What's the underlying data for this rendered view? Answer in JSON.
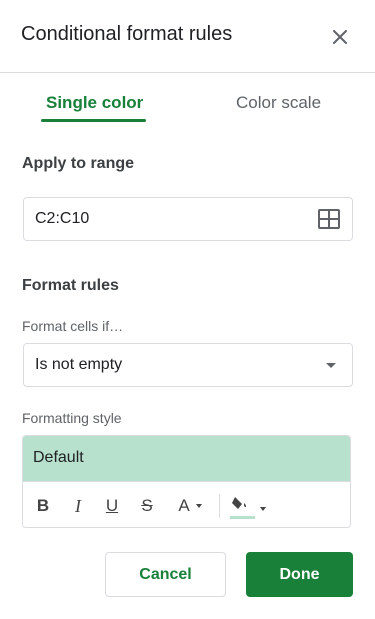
{
  "dialog": {
    "title": "Conditional format rules",
    "close_icon": "close-icon"
  },
  "tabs": [
    {
      "label": "Single color",
      "active": true
    },
    {
      "label": "Color scale",
      "active": false
    }
  ],
  "range": {
    "label": "Apply to range",
    "value": "C2:C10",
    "icon": "grid-select-icon"
  },
  "format_rules": {
    "label": "Format rules",
    "condition_label": "Format cells if…",
    "condition_value": "Is not empty"
  },
  "formatting_style": {
    "label": "Formatting style",
    "preview_text": "Default",
    "preview_color": "#b7e1cd",
    "toolbar": {
      "bold": "B",
      "italic": "I",
      "underline": "U",
      "strikethrough": "S",
      "text_color": "A",
      "fill_color_icon": "paint-bucket-icon"
    }
  },
  "buttons": {
    "cancel": "Cancel",
    "done": "Done"
  },
  "colors": {
    "accent": "#188038",
    "border": "#dadce0"
  }
}
